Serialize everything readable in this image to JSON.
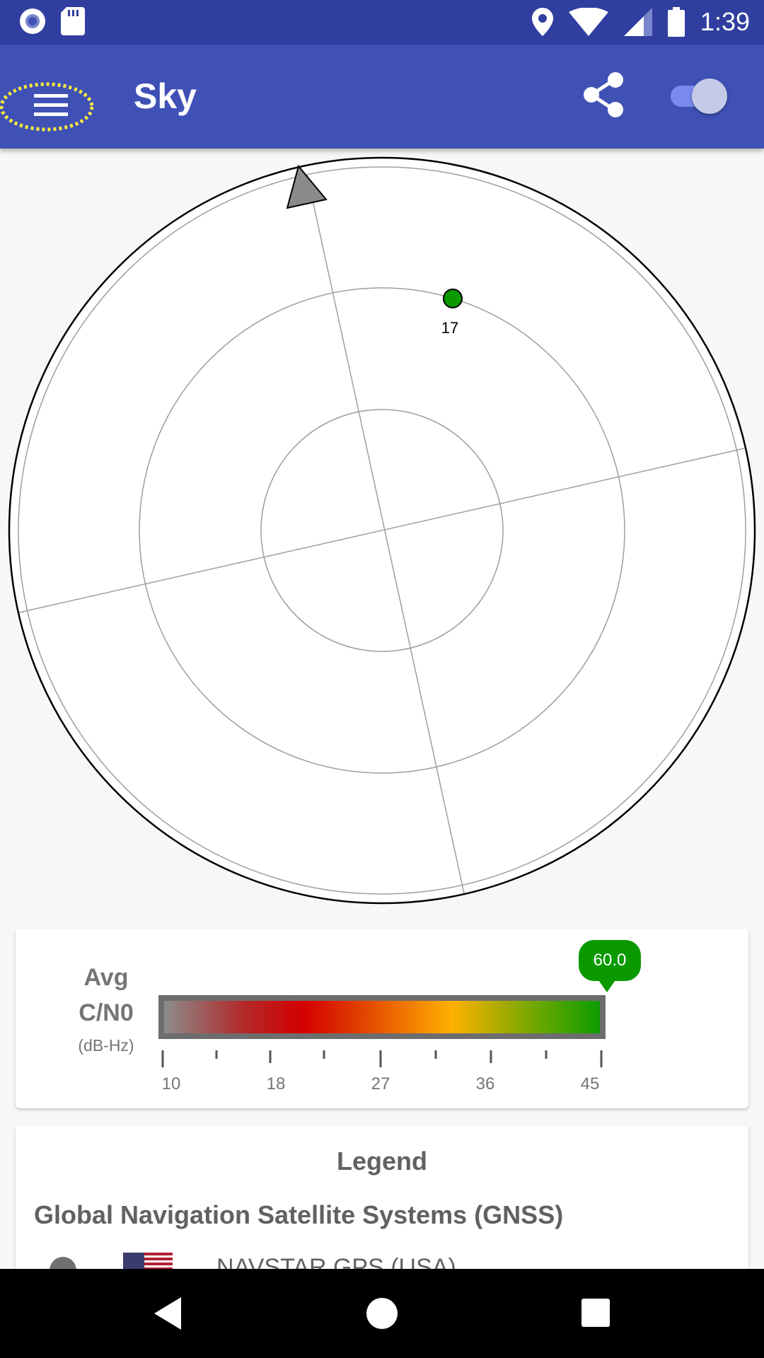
{
  "status_bar": {
    "time": "1:39",
    "icons": [
      "record-icon",
      "sd-card-icon",
      "location-icon",
      "wifi-icon",
      "cell-signal-icon",
      "battery-icon"
    ]
  },
  "app_bar": {
    "title": "Sky",
    "menu_icon": "hamburger-menu-icon",
    "share_icon": "share-icon",
    "toggle_on": true
  },
  "skyplot": {
    "satellites": [
      {
        "id": "17",
        "color": "#0a9a00"
      }
    ]
  },
  "cn0": {
    "title_line1": "Avg",
    "title_line2": "C/N0",
    "unit": "(dB-Hz)",
    "value": "60.0",
    "ticks": [
      "10",
      "18",
      "27",
      "36",
      "45"
    ],
    "bubble_color": "#0a9a00"
  },
  "legend": {
    "title": "Legend",
    "section": "Global Navigation Satellite Systems (GNSS)",
    "rows": [
      {
        "name": "NAVSTAR GPS (USA)",
        "flag": "usa-flag-icon"
      }
    ]
  },
  "colors": {
    "status_bar": "#303f9f",
    "app_bar": "#3f51b5",
    "accent_toggle": "#8c9eff"
  }
}
